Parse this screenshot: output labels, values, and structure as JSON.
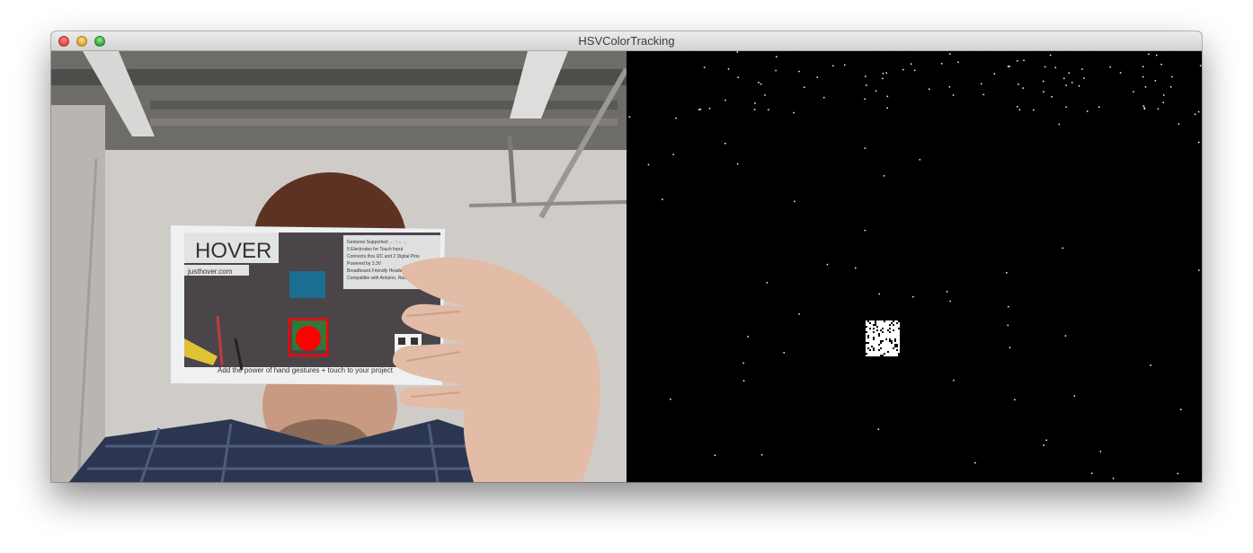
{
  "window": {
    "title": "HSVColorTracking",
    "traffic_lights": [
      "close",
      "minimize",
      "zoom"
    ]
  },
  "camera_feed": {
    "card": {
      "brand": "HOVER",
      "url": "justhover.com",
      "specs": [
        "Gestures Supported: ← ↑ ↓ →",
        "5 Electrodes for Touch Input",
        "Connects thru I2C and 2 Digital Pins",
        "Powered by 3.3V",
        "Breadboard Friendly Header",
        "Compatible with Arduino, Raspberry Pi"
      ],
      "tagline": "Add the power of hand gestures + touch to your project"
    },
    "tracking_box_color": "#ff0000",
    "tracked_marker_color": "#ff0000"
  },
  "threshold_view": {
    "background": "#000000",
    "pixel_color": "#ffffff"
  }
}
